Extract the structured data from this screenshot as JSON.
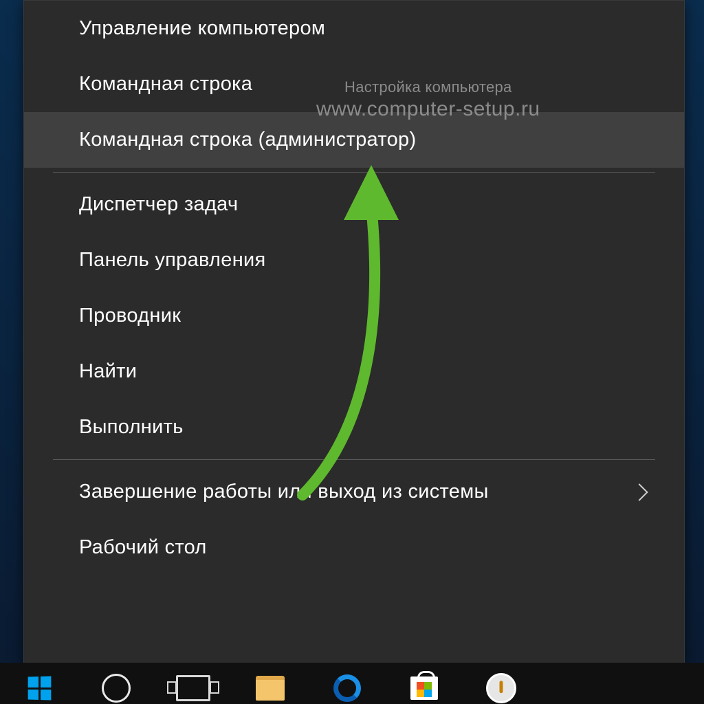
{
  "menu": {
    "items": [
      {
        "label": "Управление компьютером",
        "hover": false,
        "submenu": false
      },
      {
        "label": "Командная строка",
        "hover": false,
        "submenu": false
      },
      {
        "label": "Командная строка (администратор)",
        "hover": true,
        "submenu": false
      }
    ],
    "group2": [
      {
        "label": "Диспетчер задач",
        "hover": false,
        "submenu": false
      },
      {
        "label": "Панель управления",
        "hover": false,
        "submenu": false
      },
      {
        "label": "Проводник",
        "hover": false,
        "submenu": false
      },
      {
        "label": "Найти",
        "hover": false,
        "submenu": false
      },
      {
        "label": "Выполнить",
        "hover": false,
        "submenu": false
      }
    ],
    "group3": [
      {
        "label": "Завершение работы или выход из системы",
        "hover": false,
        "submenu": true
      },
      {
        "label": "Рабочий стол",
        "hover": false,
        "submenu": false
      }
    ]
  },
  "watermark": {
    "line1": "Настройка компьютера",
    "line2": "www.computer-setup.ru"
  },
  "annotation": {
    "arrow_color": "#5fb92e"
  },
  "taskbar": {
    "icons": [
      "start",
      "cortana",
      "task-view",
      "file-explorer",
      "edge",
      "store",
      "tips"
    ]
  }
}
